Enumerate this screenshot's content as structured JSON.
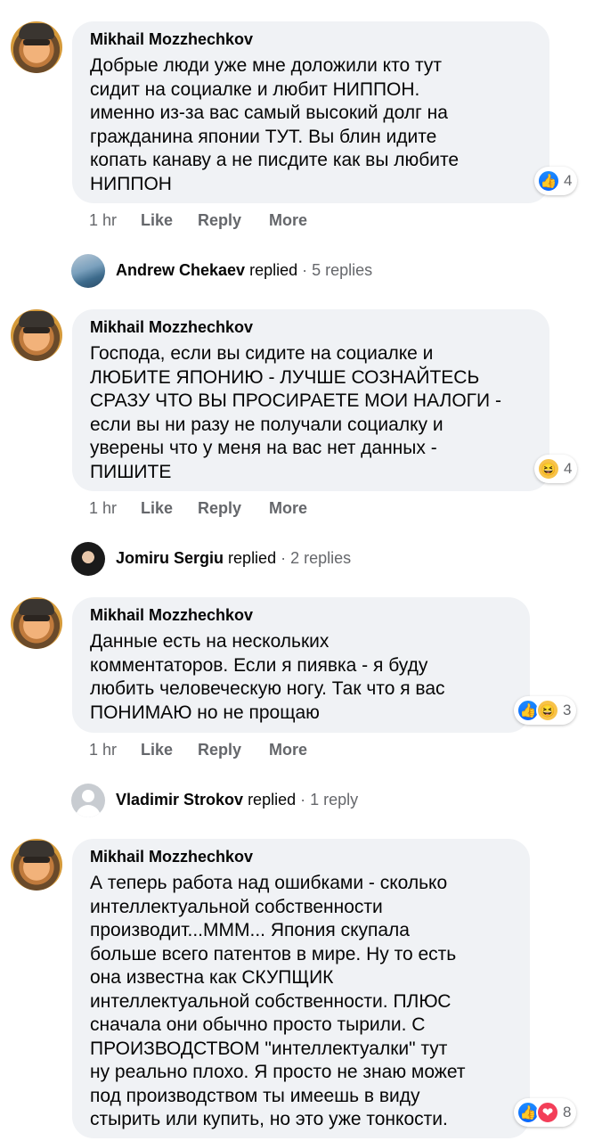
{
  "comments": [
    {
      "author": "Mikhail Mozzhechkov",
      "text": "Добрые люди уже мне доложили кто тут\nсидит на социалке и любит НИППОН.\nименно из-за вас самый высокий долг на\nгражданина японии ТУТ. Вы блин идите\nкопать канаву а не писдите как вы любите\nНИППОН",
      "reaction_count": "4",
      "time": "1 hr",
      "like": "Like",
      "reply": "Reply",
      "more": "More",
      "replied_by": "Andrew Chekaev",
      "replied_word": "replied",
      "reply_count": "· 5 replies"
    },
    {
      "author": "Mikhail Mozzhechkov",
      "text": "Господа, если вы сидите на социалке и\nЛЮБИТЕ ЯПОНИЮ - ЛУЧШЕ СОЗНАЙТЕСЬ\nСРАЗУ ЧТО ВЫ ПРОСИРАЕТЕ МОИ НАЛОГИ -\nесли вы ни разу не получали социалку и\nуверены что у меня на вас нет данных -\nПИШИТЕ",
      "reaction_count": "4",
      "time": "1 hr",
      "like": "Like",
      "reply": "Reply",
      "more": "More",
      "replied_by": "Jomiru Sergiu",
      "replied_word": "replied",
      "reply_count": "· 2 replies"
    },
    {
      "author": "Mikhail Mozzhechkov",
      "text": "Данные есть на нескольких\nкомментаторов. Если я пиявка - я буду\nлюбить человеческую ногу. Так что я вас\nПОНИМАЮ но не прощаю",
      "reaction_count": "3",
      "time": "1 hr",
      "like": "Like",
      "reply": "Reply",
      "more": "More",
      "replied_by": "Vladimir Strokov",
      "replied_word": "replied",
      "reply_count": "· 1 reply"
    },
    {
      "author": "Mikhail Mozzhechkov",
      "text": "А теперь работа над ошибками - сколько\nинтеллектуальной собственности\nпроизводит...МММ... Япония скупала\nбольше всего патентов в мире. Ну то есть\nона известна как СКУПЩИК\nинтеллектуальной собственности. ПЛЮС\nсначала они обычно просто тырили. С\nПРОИЗВОДСТВОМ \"интеллектуалки\" тут\nну реально плохо. Я просто не знаю может\nпод производством ты имеешь в виду\nстырить или купить, но это уже тонкости.",
      "reaction_count": "8"
    }
  ],
  "colors": {
    "bubble": "#f0f2f5",
    "secondary_text": "#65676b",
    "like_blue": "#0866ff"
  }
}
